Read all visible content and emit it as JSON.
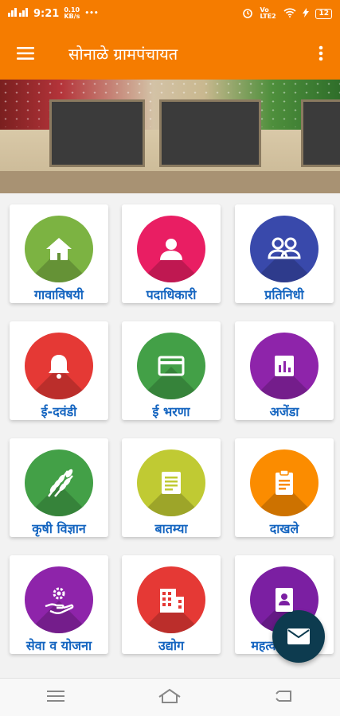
{
  "status_bar": {
    "signal_text": "ííí",
    "time": "9:21",
    "speed": "0.10\nKB/s",
    "extra": "•••",
    "battery": "12",
    "network": "Vo LTE2"
  },
  "app_bar": {
    "title": "सोनाळे ग्रामपंचायत",
    "menu_icon": "hamburger-icon",
    "more_icon": "more-vert-icon"
  },
  "tiles": [
    {
      "label": "गावाविषयी",
      "color": "#7cb342",
      "icon": "home-icon"
    },
    {
      "label": "पदाधिकारी",
      "color": "#e91e63",
      "icon": "person-icon"
    },
    {
      "label": "प्रतिनिधी",
      "color": "#3949ab",
      "icon": "people-icon"
    },
    {
      "label": "ई-दवंडी",
      "color": "#e53935",
      "icon": "bell-icon"
    },
    {
      "label": "ई भरणा",
      "color": "#43a047",
      "icon": "card-icon"
    },
    {
      "label": "अजेंडा",
      "color": "#8e24aa",
      "icon": "chart-icon"
    },
    {
      "label": "कृषी विज्ञान",
      "color": "#43a047",
      "icon": "wheat-icon"
    },
    {
      "label": "बातम्या",
      "color": "#c0ca33",
      "icon": "news-icon"
    },
    {
      "label": "दाखले",
      "color": "#fb8c00",
      "icon": "clipboard-icon"
    },
    {
      "label": "सेवा व योजना",
      "color": "#8e24aa",
      "icon": "service-hand-icon"
    },
    {
      "label": "उद्योग",
      "color": "#e53935",
      "icon": "building-icon"
    },
    {
      "label": "महत्वाचे संपर्क",
      "color": "#7b1fa2",
      "icon": "contact-icon"
    }
  ],
  "fab": {
    "icon": "mail-icon"
  },
  "nav_bar": {
    "icons": [
      "recents-icon",
      "home-nav-icon",
      "back-icon"
    ]
  }
}
